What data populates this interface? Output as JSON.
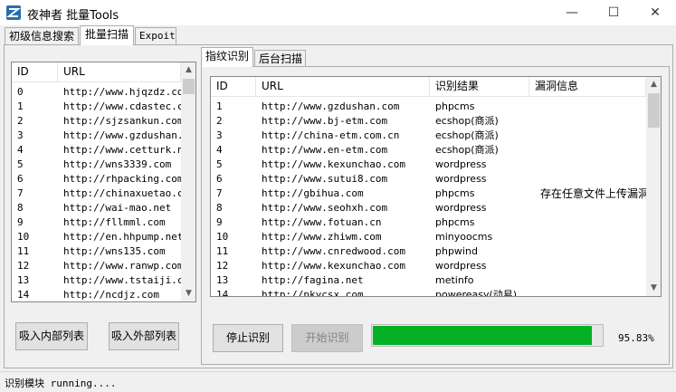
{
  "window": {
    "title": "夜神者 批量Tools",
    "minimize": "—",
    "maximize": "☐",
    "close": "✕"
  },
  "tabs": [
    {
      "label": "初级信息搜索"
    },
    {
      "label": "批量扫描"
    },
    {
      "label": "Expoit"
    }
  ],
  "left_list": {
    "columns": [
      "ID",
      "URL"
    ],
    "rows": [
      {
        "id": "0",
        "url": "http://www.hjqzdz.com"
      },
      {
        "id": "1",
        "url": "http://www.cdastec.com"
      },
      {
        "id": "2",
        "url": "http://sjzsankun.com"
      },
      {
        "id": "3",
        "url": "http://www.gzdushan.co"
      },
      {
        "id": "4",
        "url": "http://www.cetturk.net"
      },
      {
        "id": "5",
        "url": "http://wns3339.com"
      },
      {
        "id": "6",
        "url": "http://rhpacking.com"
      },
      {
        "id": "7",
        "url": "http://chinaxuetao.com"
      },
      {
        "id": "8",
        "url": "http://wai-mao.net"
      },
      {
        "id": "9",
        "url": "http://fllmml.com"
      },
      {
        "id": "10",
        "url": "http://en.hhpump.net"
      },
      {
        "id": "11",
        "url": "http://wns135.com"
      },
      {
        "id": "12",
        "url": "http://www.ranwp.com"
      },
      {
        "id": "13",
        "url": "http://www.tstaiji.com"
      },
      {
        "id": "14",
        "url": "http://ncdjz.com"
      }
    ]
  },
  "left_buttons": {
    "import_internal": "吸入内部列表",
    "import_external": "吸入外部列表"
  },
  "subtabs": [
    {
      "label": "指纹识别"
    },
    {
      "label": "后台扫描"
    }
  ],
  "result_list": {
    "columns": [
      "ID",
      "URL",
      "识别结果",
      "漏洞信息"
    ],
    "rows": [
      {
        "id": "1",
        "url": "http://www.gzdushan.com",
        "result": "phpcms",
        "vuln": ""
      },
      {
        "id": "2",
        "url": "http://www.bj-etm.com",
        "result": "ecshop(商派)",
        "vuln": ""
      },
      {
        "id": "3",
        "url": "http://china-etm.com.cn",
        "result": "ecshop(商派)",
        "vuln": ""
      },
      {
        "id": "4",
        "url": "http://www.en-etm.com",
        "result": "ecshop(商派)",
        "vuln": ""
      },
      {
        "id": "5",
        "url": "http://www.kexunchao.com",
        "result": "wordpress",
        "vuln": ""
      },
      {
        "id": "6",
        "url": "http://www.sutui8.com",
        "result": "wordpress",
        "vuln": ""
      },
      {
        "id": "7",
        "url": "http://gbihua.com",
        "result": "phpcms",
        "vuln": "存在任意文件上传漏洞"
      },
      {
        "id": "8",
        "url": "http://www.seohxh.com",
        "result": "wordpress",
        "vuln": ""
      },
      {
        "id": "9",
        "url": "http://www.fotuan.cn",
        "result": "phpcms",
        "vuln": ""
      },
      {
        "id": "10",
        "url": "http://www.zhiwm.com",
        "result": "minyoocms",
        "vuln": ""
      },
      {
        "id": "11",
        "url": "http://www.cnredwood.com",
        "result": "phpwind",
        "vuln": ""
      },
      {
        "id": "12",
        "url": "http://www.kexunchao.com",
        "result": "wordpress",
        "vuln": ""
      },
      {
        "id": "13",
        "url": "http://fagina.net",
        "result": "metinfo",
        "vuln": ""
      },
      {
        "id": "14",
        "url": "http://pkycsx.com",
        "result": "powereasy(动易)",
        "vuln": ""
      }
    ]
  },
  "actions": {
    "stop": "停止识别",
    "start": "开始识别"
  },
  "progress": {
    "value": 0.9583,
    "label": "95.83%"
  },
  "status": "识别模块 running....",
  "colors": {
    "progress_fill": "#06b025",
    "accent": "#0078d7"
  }
}
